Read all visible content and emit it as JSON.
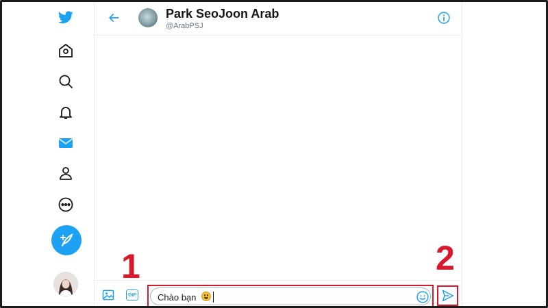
{
  "conversation": {
    "name": "Park SeoJoon Arab",
    "handle": "@ArabPSJ"
  },
  "composer": {
    "message_text": "Chào bạn",
    "gif_label": "GIF"
  },
  "annotations": {
    "step1": "1",
    "step2": "2"
  },
  "colors": {
    "accent": "#1da1f2",
    "highlight": "#d7192b"
  },
  "icons": {
    "nav": [
      "twitter-logo-icon",
      "home-icon",
      "search-icon",
      "notifications-bell-icon",
      "messages-mail-icon",
      "profile-icon",
      "more-icon"
    ],
    "compose": "compose-tweet-icon",
    "header": [
      "back-arrow-icon",
      "info-icon"
    ],
    "composer": [
      "image-icon",
      "gif-icon",
      "emoji-icon",
      "send-icon"
    ]
  }
}
